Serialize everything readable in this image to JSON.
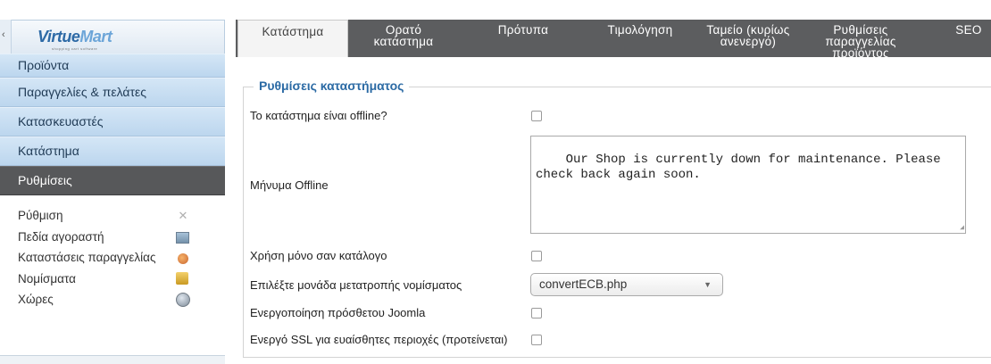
{
  "sidebar": {
    "collapse_glyph": "‹",
    "logo": {
      "part1": "Virtue",
      "part2": "Mart",
      "tagline": "shopping cart software"
    },
    "nav": [
      {
        "label": "Προϊόντα"
      },
      {
        "label": "Παραγγελίες & πελάτες"
      },
      {
        "label": "Κατασκευαστές"
      },
      {
        "label": "Κατάστημα"
      },
      {
        "label": "Ρυθμίσεις",
        "active": true
      }
    ],
    "subnav": [
      {
        "label": "Ρύθμιση",
        "icon": "config-icon"
      },
      {
        "label": "Πεδία αγοραστή",
        "icon": "shopper-fields-icon"
      },
      {
        "label": "Καταστάσεις παραγγελίας",
        "icon": "order-status-icon"
      },
      {
        "label": "Νομίσματα",
        "icon": "currency-icon"
      },
      {
        "label": "Χώρες",
        "icon": "globe-icon"
      }
    ]
  },
  "tabs": [
    {
      "line1": "Κατάστημα",
      "line2": "",
      "active": true
    },
    {
      "line1": "Ορατό",
      "line2": "κατάστημα"
    },
    {
      "line1": "Πρότυπα",
      "line2": ""
    },
    {
      "line1": "Τιμολόγηση",
      "line2": ""
    },
    {
      "line1": "Ταμείο (κυρίως",
      "line2": "ανενεργό)"
    },
    {
      "line1": "Ρυθμίσεις",
      "line2": "παραγγελίας",
      "line3": "προϊόντος"
    },
    {
      "line1": "SEO",
      "line2": ""
    }
  ],
  "form": {
    "legend": "Ρυθμίσεις καταστήματος",
    "offline_label": "Το κατάστημα είναι offline?",
    "offline_checked": false,
    "offline_message_label": "Μήνυμα Offline",
    "offline_message_value": "Our Shop is currently down for maintenance. Please\ncheck back again soon.",
    "catalog_only_label": "Χρήση μόνο σαν κατάλογο",
    "catalog_only_checked": false,
    "currency_converter_label": "Επιλέξτε μονάδα μετατροπής νομίσματος",
    "currency_converter_value": "convertECB.php",
    "joomla_label": "Ενεργοποίηση πρόσθετου Joomla",
    "joomla_checked": false,
    "ssl_label": "Ενεργό SSL για ευαίσθητες περιοχές (προτείνεται)",
    "ssl_checked": false
  },
  "colors": {
    "tabbar_bg": "#5c5d5f",
    "nav_bg": "#c8dcef",
    "nav_active_bg": "#57585a",
    "legend_color": "#2b6aa4"
  }
}
